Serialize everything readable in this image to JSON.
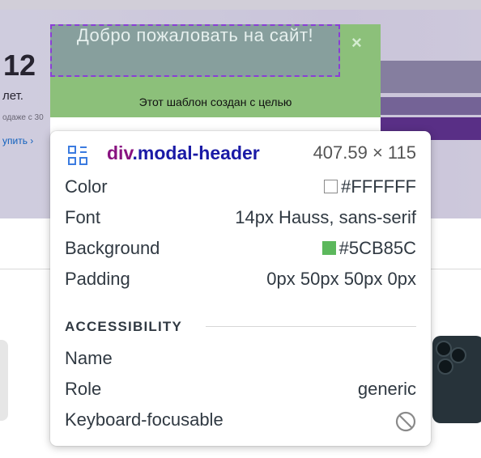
{
  "background_page": {
    "big_number": "12",
    "years_text": "лет.",
    "tiny_text": "одаже с 30",
    "buy_link": "упить ›"
  },
  "modal": {
    "title": "Добро пожаловать на сайт!",
    "close_label": "×",
    "body_text": "Этот шаблон создан с целью"
  },
  "inspector": {
    "tag": "div",
    "class_name": ".modal-header",
    "dimensions": "407.59 × 115",
    "properties": [
      {
        "label": "Color",
        "value": "#FFFFFF",
        "swatch": "#FFFFFF"
      },
      {
        "label": "Font",
        "value": "14px Hauss, sans-serif"
      },
      {
        "label": "Background",
        "value": "#5CB85C",
        "swatch": "#5CB85C"
      },
      {
        "label": "Padding",
        "value": "0px 50px 50px 0px"
      }
    ],
    "accessibility": {
      "section_title": "ACCESSIBILITY",
      "name_label": "Name",
      "name_value": "",
      "role_label": "Role",
      "role_value": "generic",
      "focusable_label": "Keyboard-focusable",
      "focusable_icon": "not-allowed-icon"
    }
  },
  "colors": {
    "header_green": "#5CB85C",
    "tag_purple": "#881280",
    "class_blue": "#1a1aa6"
  }
}
